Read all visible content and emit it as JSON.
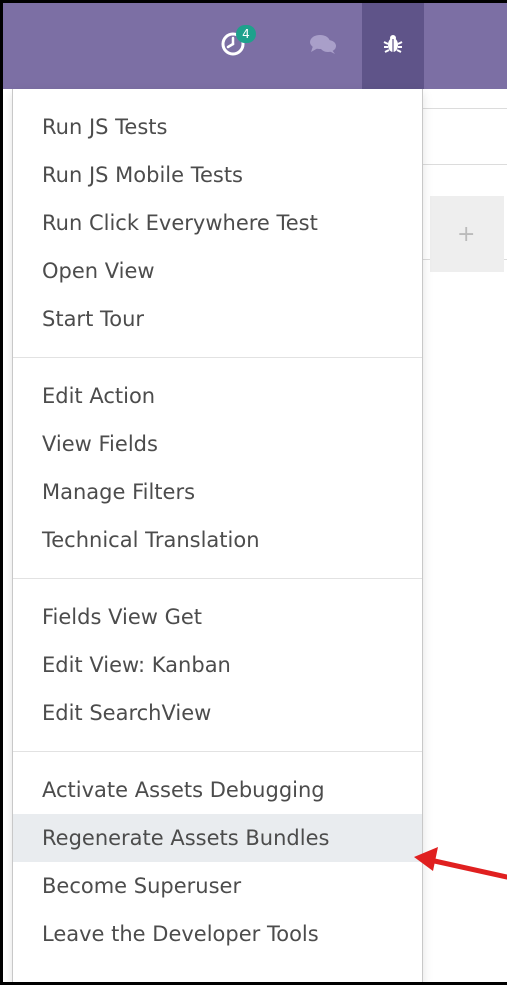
{
  "navbar": {
    "activity_icon": "clock-icon",
    "activity_badge": "4",
    "discuss_icon": "chat-bubbles-icon",
    "debug_icon": "bug-icon"
  },
  "background": {
    "add_icon": "+"
  },
  "menu": {
    "section_1": [
      {
        "label": "Run JS Tests"
      },
      {
        "label": "Run JS Mobile Tests"
      },
      {
        "label": "Run Click Everywhere Test"
      },
      {
        "label": "Open View"
      },
      {
        "label": "Start Tour"
      }
    ],
    "section_2": [
      {
        "label": "Edit Action"
      },
      {
        "label": "View Fields"
      },
      {
        "label": "Manage Filters"
      },
      {
        "label": "Technical Translation"
      }
    ],
    "section_3": [
      {
        "label": "Fields View Get"
      },
      {
        "label": "Edit View: Kanban"
      },
      {
        "label": "Edit SearchView"
      }
    ],
    "section_4": [
      {
        "label": "Activate Assets Debugging"
      },
      {
        "label": "Regenerate Assets Bundles"
      },
      {
        "label": "Become Superuser"
      },
      {
        "label": "Leave the Developer Tools"
      }
    ],
    "highlighted_item": "Regenerate Assets Bundles"
  },
  "colors": {
    "navbar": "#7c6fa4",
    "navbar_active": "#5f5489",
    "badge": "#1ea18c",
    "annotation_arrow": "#e02020"
  }
}
